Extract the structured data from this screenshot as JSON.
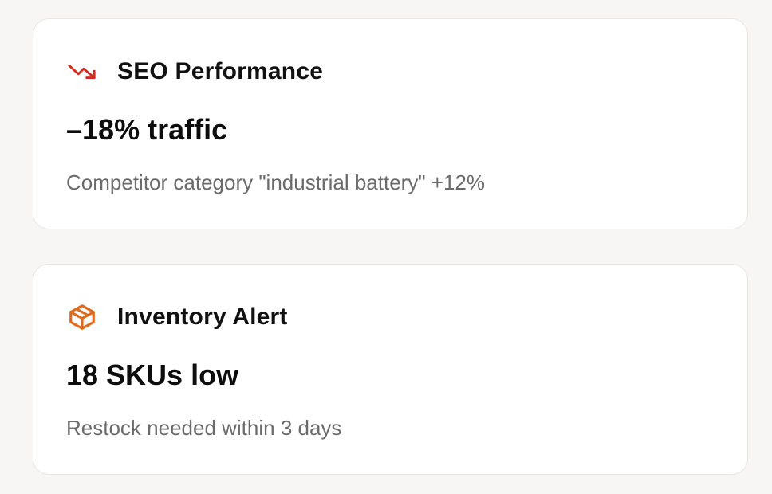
{
  "cards": [
    {
      "icon": "trending-down-icon",
      "icon_color": "#d42b1e",
      "title": "SEO Performance",
      "value": "–18% traffic",
      "subtitle": "Competitor category \"industrial battery\" +12%"
    },
    {
      "icon": "package-icon",
      "icon_color": "#e06a1b",
      "title": "Inventory Alert",
      "value": "18 SKUs low",
      "subtitle": "Restock needed within 3 days"
    }
  ]
}
